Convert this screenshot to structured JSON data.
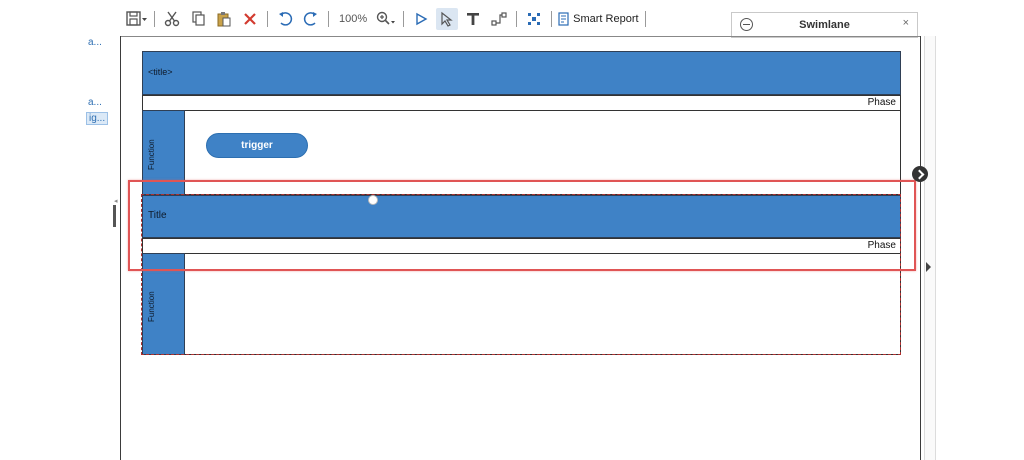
{
  "left_panel": {
    "items": [
      {
        "label": "a..."
      },
      {
        "label": "a..."
      },
      {
        "label": "ig..."
      }
    ]
  },
  "toolbar": {
    "zoom": "100%",
    "smart_report": "Smart Report"
  },
  "panel": {
    "title": "Swimlane",
    "close": "×"
  },
  "pool1": {
    "title": "<title>",
    "phase": "Phase",
    "function": "Function",
    "shape_label": "trigger"
  },
  "pool2": {
    "title": "Title",
    "phase": "Phase",
    "function": "Function"
  },
  "colors": {
    "lane_blue": "#3f82c6",
    "highlight_red": "#e05555",
    "selection_dashed": "#b03030"
  }
}
